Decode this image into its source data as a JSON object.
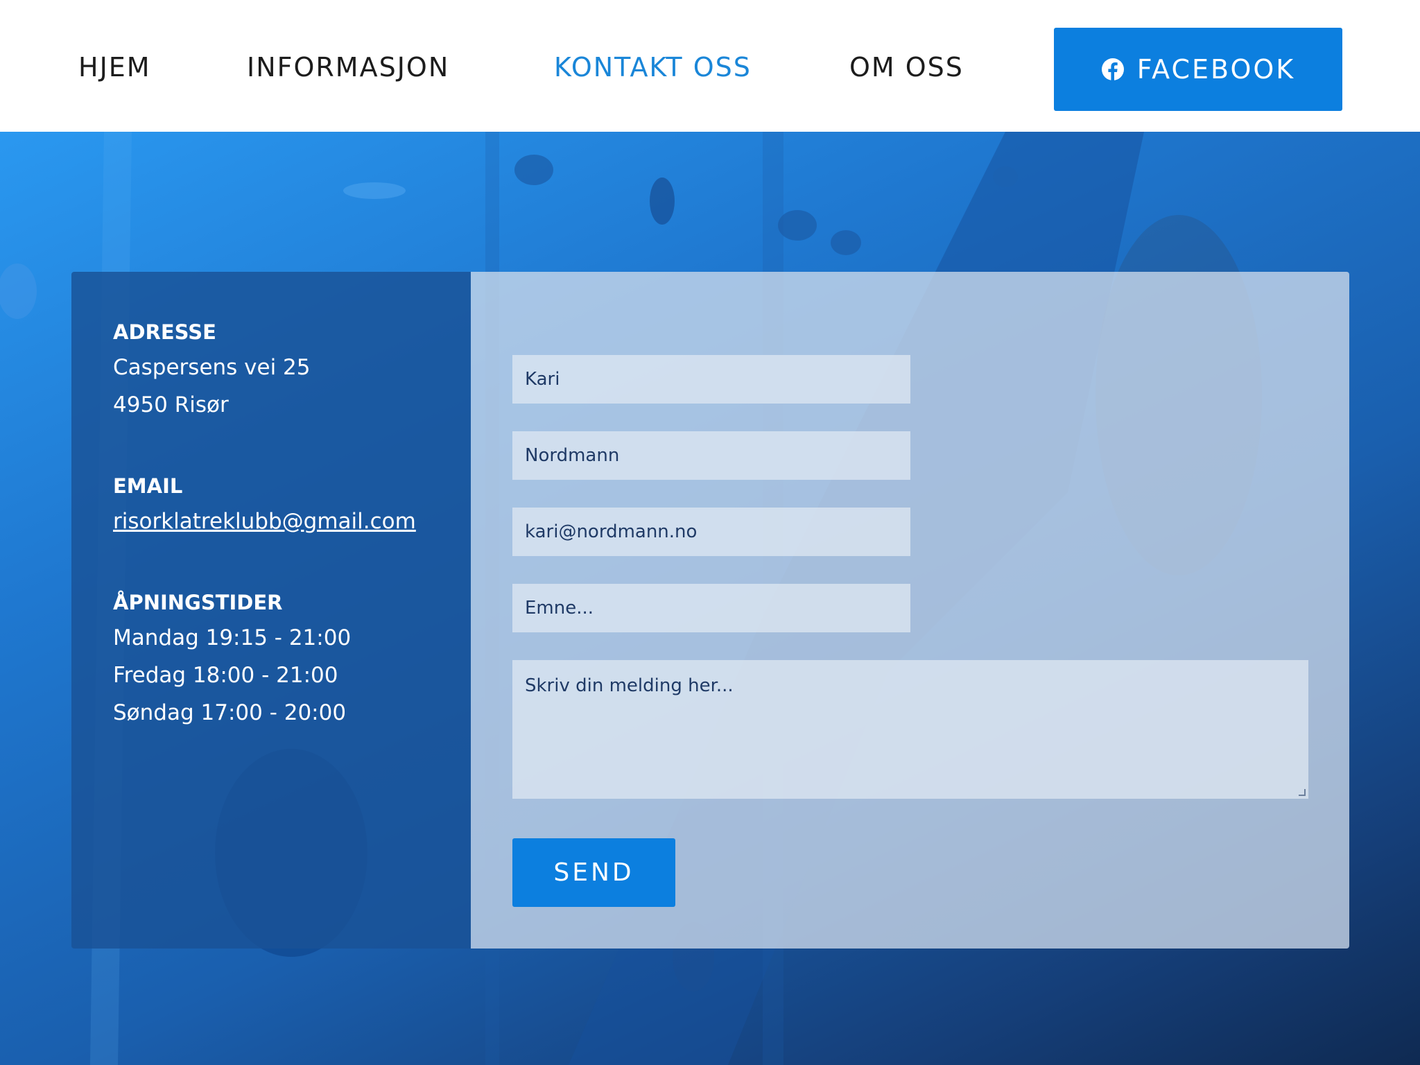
{
  "nav": {
    "items": [
      {
        "label": "HJEM"
      },
      {
        "label": "INFORMASJON"
      },
      {
        "label": "KONTAKT OSS"
      },
      {
        "label": "OM OSS"
      }
    ],
    "facebook_label": "FACEBOOK",
    "facebook_icon": "facebook-icon",
    "active_color": "#1a86d8",
    "button_color": "#0c7fdf"
  },
  "contact": {
    "address_heading": "ADRESSE",
    "address_lines": [
      "Caspersens vei 25",
      "4950 Risør"
    ],
    "email_heading": "EMAIL",
    "email": "risorklatreklubb@gmail.com",
    "hours_heading": "ÅPNINGSTIDER",
    "hours": [
      "Mandag 19:15 - 21:00",
      "Fredag 18:00 - 21:00",
      "Søndag 17:00 - 20:00"
    ]
  },
  "form": {
    "first_name": "Kari",
    "last_name": "Nordmann",
    "email": "kari@nordmann.no",
    "subject_placeholder": "Emne...",
    "message_placeholder": "Skriv din melding her...",
    "send_label": "SEND"
  }
}
